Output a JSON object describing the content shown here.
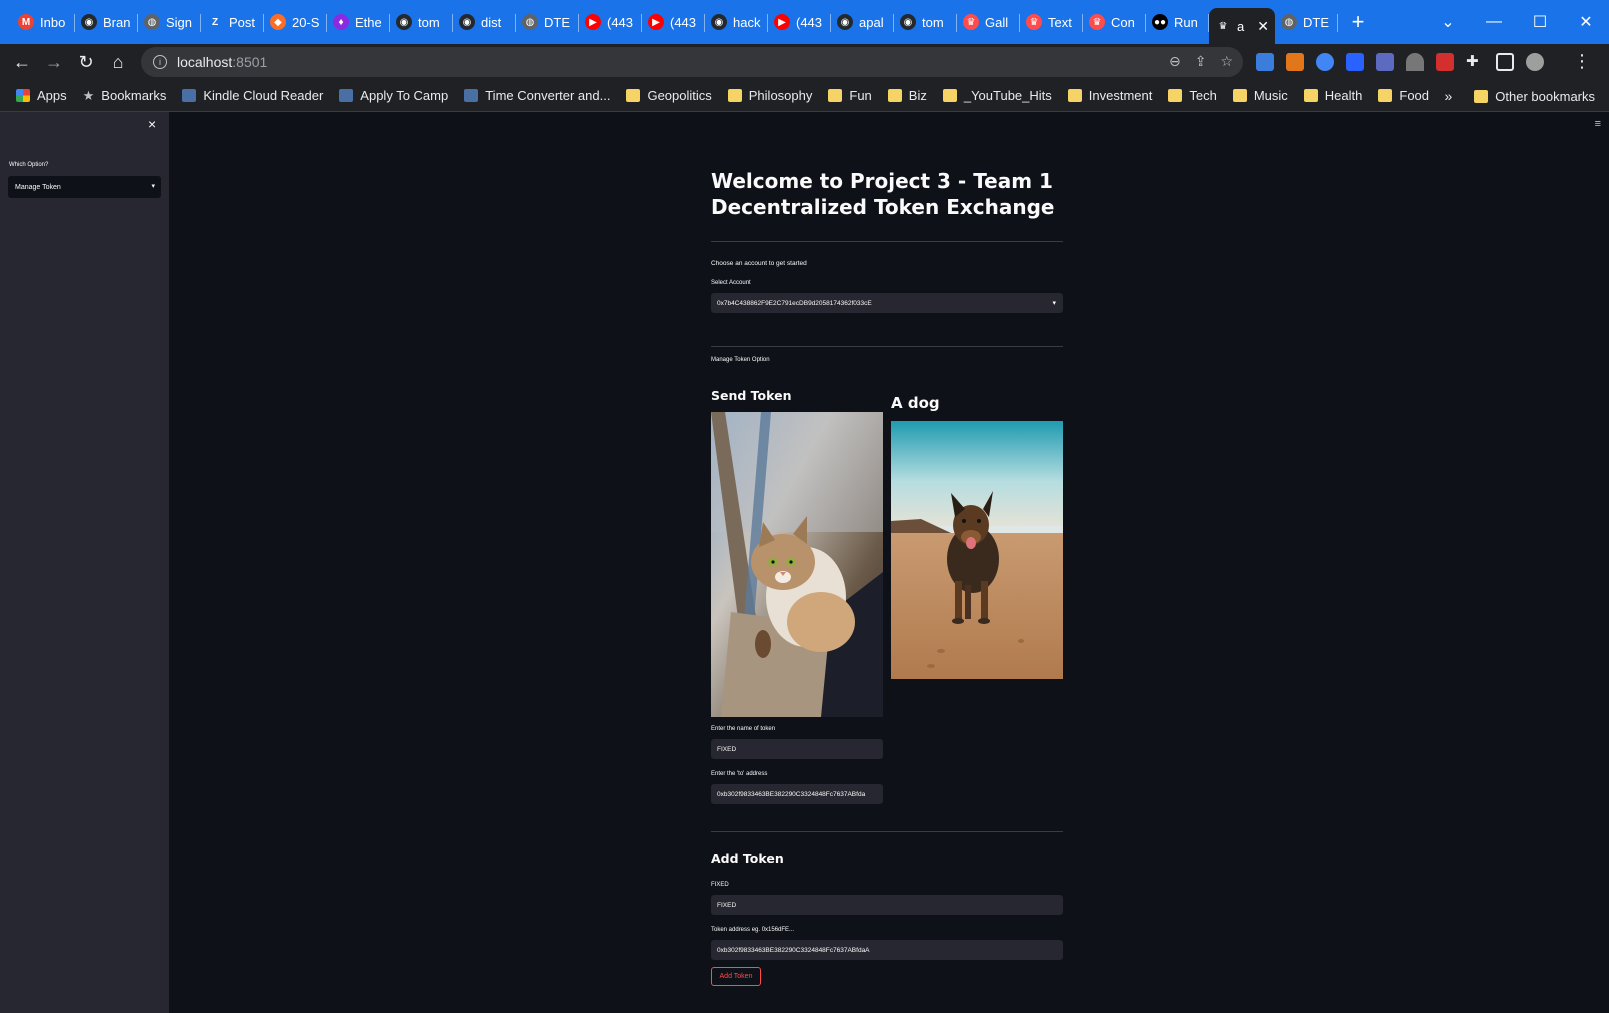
{
  "browser": {
    "tabs": [
      {
        "label": "Inbo",
        "icon": "gmail-icon",
        "color": "#ea4335",
        "glyph": "M"
      },
      {
        "label": "Bran",
        "icon": "github-icon",
        "color": "#24292e",
        "glyph": "◉"
      },
      {
        "label": "Sign",
        "icon": "globe-icon",
        "color": "#5f6368",
        "glyph": "◍"
      },
      {
        "label": "Post",
        "icon": "zoho-icon",
        "color": "#1a73e8",
        "glyph": "Z"
      },
      {
        "label": "20-S",
        "icon": "gitlab-icon",
        "color": "#fc6d26",
        "glyph": "◆"
      },
      {
        "label": "Ethe",
        "icon": "ethereum-icon",
        "color": "#8a2be2",
        "glyph": "♦"
      },
      {
        "label": "tom",
        "icon": "github-icon",
        "color": "#24292e",
        "glyph": "◉"
      },
      {
        "label": "dist",
        "icon": "github-icon",
        "color": "#24292e",
        "glyph": "◉"
      },
      {
        "label": "DTE",
        "icon": "globe-icon",
        "color": "#5f6368",
        "glyph": "◍"
      },
      {
        "label": "(443",
        "icon": "youtube-icon",
        "color": "#ff0000",
        "glyph": "▶"
      },
      {
        "label": "(443",
        "icon": "youtube-icon",
        "color": "#ff0000",
        "glyph": "▶"
      },
      {
        "label": "hack",
        "icon": "github-icon",
        "color": "#24292e",
        "glyph": "◉"
      },
      {
        "label": "(443",
        "icon": "youtube-icon",
        "color": "#ff0000",
        "glyph": "▶"
      },
      {
        "label": "apal",
        "icon": "github-icon",
        "color": "#24292e",
        "glyph": "◉"
      },
      {
        "label": "tom",
        "icon": "github-icon",
        "color": "#24292e",
        "glyph": "◉"
      },
      {
        "label": "Gall",
        "icon": "streamlit-icon",
        "color": "#ff4b4b",
        "glyph": "♛"
      },
      {
        "label": "Text",
        "icon": "streamlit-icon",
        "color": "#ff4b4b",
        "glyph": "♛"
      },
      {
        "label": "Con",
        "icon": "streamlit-icon",
        "color": "#ff4b4b",
        "glyph": "♛"
      },
      {
        "label": "Run",
        "icon": "medium-icon",
        "color": "#000000",
        "glyph": "●●"
      }
    ],
    "active_tab": {
      "label": "a",
      "icon": "streamlit-icon",
      "glyph": "♛"
    },
    "after_tab": {
      "label": "DTE",
      "icon": "globe-icon",
      "glyph": "◍"
    },
    "url_host": "localhost",
    "url_port": ":8501",
    "bookmarks": [
      {
        "label": "Apps",
        "icon": "apps-grid-icon",
        "kind": "apps"
      },
      {
        "label": "Bookmarks",
        "icon": "star-icon",
        "kind": "star"
      },
      {
        "label": "Kindle Cloud Reader",
        "icon": "kindle-icon",
        "kind": "site"
      },
      {
        "label": "Apply To Camp",
        "icon": "camp-icon",
        "kind": "site"
      },
      {
        "label": "Time Converter and...",
        "icon": "time-icon",
        "kind": "site"
      },
      {
        "label": "Geopolitics",
        "icon": "folder-icon",
        "kind": "folder"
      },
      {
        "label": "Philosophy",
        "icon": "folder-icon",
        "kind": "folder"
      },
      {
        "label": "Fun",
        "icon": "folder-icon",
        "kind": "folder"
      },
      {
        "label": "Biz",
        "icon": "folder-icon",
        "kind": "folder"
      },
      {
        "label": "_YouTube_Hits",
        "icon": "folder-icon",
        "kind": "folder"
      },
      {
        "label": "Investment",
        "icon": "folder-icon",
        "kind": "folder"
      },
      {
        "label": "Tech",
        "icon": "folder-icon",
        "kind": "folder"
      },
      {
        "label": "Music",
        "icon": "folder-icon",
        "kind": "folder"
      },
      {
        "label": "Health",
        "icon": "folder-icon",
        "kind": "folder"
      },
      {
        "label": "Food",
        "icon": "folder-icon",
        "kind": "folder"
      }
    ],
    "other_bookmarks": "Other bookmarks",
    "overflow": "»"
  },
  "sidebar": {
    "label": "Which Option?",
    "select_value": "Manage Token",
    "caret": "⌄",
    "close": "×"
  },
  "main": {
    "title_line1": "Welcome to Project 3 - Team 1",
    "title_line2": "Decentralized Token Exchange",
    "intro": "Choose an account to get started",
    "account_label": "Select Account",
    "account_value": "0x7b4C438862F9E2C791ecDB9d2058174362f033cE",
    "manage_label": "Manage Token Option",
    "send_heading": "Send Token",
    "dog_heading": "A dog",
    "token_name_label": "Enter the name of token",
    "token_name_value": "FIXED",
    "to_address_label": "Enter the 'to' address",
    "to_address_value": "0xb302f9833463BE382290C3324848Fc7637ABfda",
    "add_heading": "Add Token",
    "add_name_label": "FIXED",
    "add_name_value": "FIXED",
    "add_addr_label": "Token address eg. 0x156dFE...",
    "add_addr_value": "0xb302f9833463BE382290C3324848Fc7637ABfdaA",
    "add_button": "Add Token"
  },
  "colors": {
    "accent": "#ff4b4b",
    "bg": "#0e1117",
    "sidebar": "#262730",
    "chrome_tabstrip": "#1a73e8"
  }
}
